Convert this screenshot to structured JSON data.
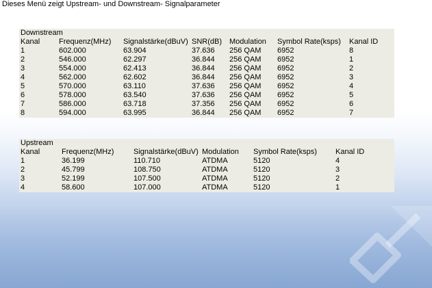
{
  "intro_text": "Dieses Menü zeigt Upstream- und Downstream- Signalparameter",
  "downstream": {
    "title": "Downstream",
    "headers": [
      "Kanal",
      "Frequenz(MHz)",
      "Signalstärke(dBuV)",
      "SNR(dB)",
      "Modulation",
      "Symbol Rate(ksps)",
      "Kanal ID"
    ],
    "rows": [
      [
        "1",
        "602.000",
        "63.904",
        "37.636",
        "256 QAM",
        "6952",
        "8"
      ],
      [
        "2",
        "546.000",
        "62.297",
        "36.844",
        "256 QAM",
        "6952",
        "1"
      ],
      [
        "3",
        "554.000",
        "62.413",
        "36.844",
        "256 QAM",
        "6952",
        "2"
      ],
      [
        "4",
        "562.000",
        "62.602",
        "36.844",
        "256 QAM",
        "6952",
        "3"
      ],
      [
        "5",
        "570.000",
        "63.110",
        "37.636",
        "256 QAM",
        "6952",
        "4"
      ],
      [
        "6",
        "578.000",
        "63.540",
        "37.636",
        "256 QAM",
        "6952",
        "5"
      ],
      [
        "7",
        "586.000",
        "63.718",
        "37.356",
        "256 QAM",
        "6952",
        "6"
      ],
      [
        "8",
        "594.000",
        "63.995",
        "36.844",
        "256 QAM",
        "6952",
        "7"
      ]
    ]
  },
  "upstream": {
    "title": "Upstream",
    "headers": [
      "Kanal",
      "Frequenz(MHz)",
      "Signalstärke(dBuV)",
      "Modulation",
      "Symbol Rate(ksps)",
      "Kanal ID"
    ],
    "rows": [
      [
        "1",
        "36.199",
        "110.710",
        "ATDMA",
        "5120",
        "4"
      ],
      [
        "2",
        "45.799",
        "108.750",
        "ATDMA",
        "5120",
        "3"
      ],
      [
        "3",
        "52.199",
        "107.500",
        "ATDMA",
        "5120",
        "2"
      ],
      [
        "4",
        "58.600",
        "107.000",
        "ATDMA",
        "5120",
        "1"
      ]
    ]
  },
  "colors": {
    "panel_background": "#ecece4",
    "gradient_bottom": "#87a6d2"
  }
}
